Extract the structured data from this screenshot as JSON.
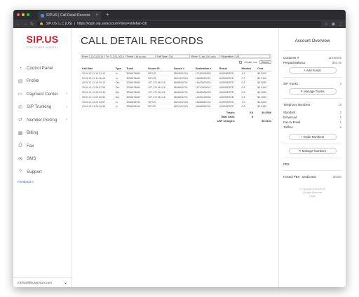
{
  "browser": {
    "tab_title": "SIP.US | Call Detail Records",
    "new_tab": "+",
    "url_site": "SIP.US LLC [US]",
    "url": "https://login.sip.us/account?view=sidebar-cdr",
    "colors": {
      "red": "#ff5f57",
      "yellow": "#febc2e",
      "green": "#28c840"
    }
  },
  "sidebar": {
    "brand": "SIP.US",
    "portal": "CUSTOMER PORTAL",
    "items": [
      {
        "label": "Control Panel",
        "icon": "gauge-icon",
        "glyph": "◔",
        "chev": ""
      },
      {
        "label": "Profile",
        "icon": "profile-icon",
        "glyph": "▤",
        "chev": ""
      },
      {
        "label": "Payment Center",
        "icon": "card-icon",
        "glyph": "▭",
        "chev": "›"
      },
      {
        "label": "SIP Trunking",
        "icon": "phone-icon",
        "glyph": "✆",
        "chev": "›"
      },
      {
        "label": "Number Porting",
        "icon": "porting-icon",
        "glyph": "⇄",
        "chev": "›"
      },
      {
        "label": "Billing",
        "icon": "billing-icon",
        "glyph": "▦",
        "chev": ""
      },
      {
        "label": "Fax",
        "icon": "fax-icon",
        "glyph": "⎙",
        "chev": ""
      },
      {
        "label": "SMS",
        "icon": "sms-icon",
        "glyph": "✉",
        "chev": ""
      },
      {
        "label": "Support",
        "icon": "support-icon",
        "glyph": "?",
        "chev": ""
      }
    ],
    "feedback": "Feedback »",
    "user_email": "michael@ituservices.com",
    "user_dropdown": "⌄"
  },
  "main": {
    "title": "CALL DETAIL RECORDS",
    "filters": {
      "from_label": "From",
      "from_value": "12/11/2019",
      "to_label": "To",
      "to_value": "12/11/2019",
      "trunk_label": "Trunk",
      "trunk_value": "all trunks",
      "calltype_label": "Call Type",
      "calltype_value": "All",
      "show_label": "Show",
      "show_value": "Last 100 calls",
      "disposition_label": "Disposition",
      "disposition_value": "All",
      "csv_label": "Create .csv",
      "search_label": "Search"
    },
    "table": {
      "headers": [
        "Call Date",
        "Type",
        "Trunk",
        "Source IP",
        "Source #",
        "Destination #",
        "Result",
        "Minutes",
        "Cost"
      ],
      "rows": [
        [
          "2019-12-11 12:21:13",
          "In",
          "3256678669",
          "SIP.US",
          "8553831224",
          "17182536595",
          "ANSWERED",
          "1.1",
          "$0.0000"
        ],
        [
          "2019-12-11 11:46:46",
          "In",
          "3256678669",
          "SIP.US",
          "5624412229",
          "18668816791",
          "ANSWERED",
          "0.7",
          "$0.0140"
        ],
        [
          "2019-12-11 10:30:13",
          "Out",
          "3256678669",
          "107.170.96.116",
          "8668816791",
          "14623603524",
          "ANSWERED",
          "0.4",
          "$0.0080"
        ],
        [
          "2019-12-11 09:57:56",
          "Out",
          "3256678669",
          "107.170.96.116",
          "8668816791",
          "15710009041",
          "ANSWERED",
          "0.8",
          "$0.0160"
        ],
        [
          "2019-12-11 09:54:49",
          "Out",
          "3256678669",
          "107.170.96.116",
          "8668816791",
          "14686636095",
          "ANSWERED",
          "0.8",
          "$0.0060"
        ],
        [
          "2019-12-11 09:52:52",
          "Out",
          "3256678669",
          "107.170.96.116",
          "8668816791",
          "14693155934",
          "ANSWERED",
          "0.2",
          "$0.0060"
        ],
        [
          "2019-12-11 09:45:57",
          "In",
          "3256638944",
          "SIP.US",
          "5624412229",
          "18668816791",
          "ANSWERED",
          "1.0",
          "$0.0200"
        ],
        [
          "2019-12-11 09:16:39",
          "In",
          "3256638944",
          "SIP.US",
          "5624412229",
          "18668816791",
          "ANSWERED",
          "0.8",
          "$0.0160"
        ]
      ]
    },
    "totals": [
      {
        "label": "Totals:",
        "value": "5.8",
        "extra": "$0.0506"
      },
      {
        "label": "Total Calls:",
        "value": "8",
        "extra": ""
      },
      {
        "label": "USF Charges:",
        "value": "",
        "extra": "$0.0101"
      }
    ]
  },
  "overview": {
    "title": "Account Overview",
    "account_label": "Customer #",
    "account_value": "11436000",
    "balance_label": "Prepaid Balance",
    "balance_value": "$83.35",
    "add_funds": "+ Add Funds",
    "trunks_label": "SIP Trunks",
    "trunks_value": "3",
    "manage_trunks": "✎ Manage Trunks",
    "tn_label": "Telephone Numbers",
    "tn_value": "10",
    "standard_label": "Standard",
    "standard_value": "2",
    "enhanced_label": "Enhanced",
    "enhanced_value": "1",
    "fax_label": "Fax-to-Email",
    "fax_value": "1",
    "tollfree_label": "Tollfree",
    "tollfree_value": "6",
    "order_numbers": "+ Order Numbers",
    "manage_numbers": "✎ Manage Numbers",
    "pbx_label": "PBX",
    "hosted_label": "Hosted PBX - Dedicated",
    "hosted_value": "details",
    "copyright": "© Copyright 2019 SIP.US",
    "rights": "All rights Reserved",
    "legal": "Legal"
  }
}
